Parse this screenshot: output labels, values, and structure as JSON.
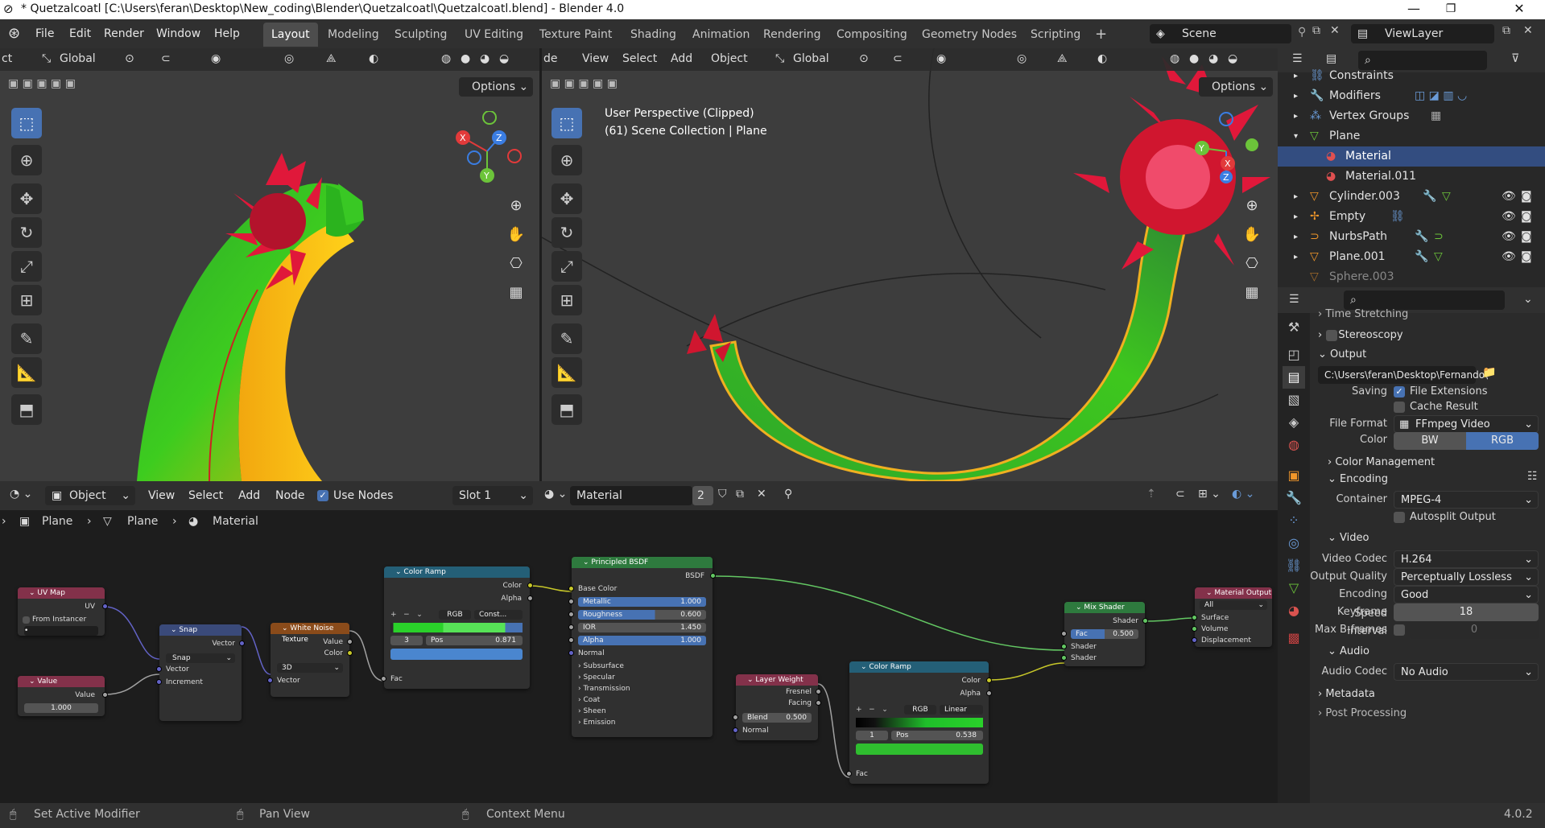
{
  "window": {
    "title": "* Quetzalcoatl [C:\\Users\\feran\\Desktop\\New_coding\\Blender\\Quetzalcoatl\\Quetzalcoatl.blend] - Blender 4.0",
    "minimize": "—",
    "maximize": "❐",
    "close": "✕"
  },
  "menu": [
    "File",
    "Edit",
    "Render",
    "Window",
    "Help"
  ],
  "workspaces": [
    "Layout",
    "Modeling",
    "Sculpting",
    "UV Editing",
    "Texture Paint",
    "Shading",
    "Animation",
    "Rendering",
    "Compositing",
    "Geometry Nodes",
    "Scripting",
    "+"
  ],
  "scene": {
    "label": "Scene",
    "viewlayer": "ViewLayer"
  },
  "viewport_left": {
    "mode_partial": "ct",
    "transform": "Global",
    "options": "Options"
  },
  "viewport_right": {
    "mode_partial": "de",
    "menus": [
      "View",
      "Select",
      "Add",
      "Object"
    ],
    "transform": "Global",
    "options": "Options",
    "info_line1": "User Perspective (Clipped)",
    "info_line2": "(61) Scene Collection | Plane"
  },
  "outliner": {
    "rows": [
      {
        "name": "Constraints",
        "icon": "constraint-icon",
        "indent": 1
      },
      {
        "name": "Modifiers",
        "icon": "wrench-icon",
        "indent": 1
      },
      {
        "name": "Vertex Groups",
        "icon": "vertex-group-icon",
        "indent": 1
      },
      {
        "name": "Plane",
        "icon": "mesh-icon",
        "indent": 1
      },
      {
        "name": "Material",
        "icon": "material-icon",
        "indent": 2
      },
      {
        "name": "Material.011",
        "icon": "material-icon",
        "indent": 2
      },
      {
        "name": "Cylinder.003",
        "icon": "object-icon",
        "indent": 1
      },
      {
        "name": "Empty",
        "icon": "object-icon",
        "indent": 1
      },
      {
        "name": "NurbsPath",
        "icon": "curve-icon",
        "indent": 1
      },
      {
        "name": "Plane.001",
        "icon": "object-icon",
        "indent": 1
      },
      {
        "name": "Sphere.003",
        "icon": "object-icon",
        "indent": 1
      }
    ]
  },
  "properties": {
    "time_stretching": "Time Stretching",
    "stereoscopy": "Stereoscopy",
    "output_header": "Output",
    "output_path": "C:\\Users\\feran\\Desktop\\Fernando\\",
    "saving_label": "Saving",
    "file_extensions": "File Extensions",
    "cache_result": "Cache Result",
    "file_format_label": "File Format",
    "file_format": "FFmpeg Video",
    "color_label": "Color",
    "color_bw": "BW",
    "color_rgb": "RGB",
    "color_management": "Color Management",
    "encoding": "Encoding",
    "container_label": "Container",
    "container": "MPEG-4",
    "autosplit": "Autosplit Output",
    "video_header": "Video",
    "video_codec_label": "Video Codec",
    "video_codec": "H.264",
    "output_quality_label": "Output Quality",
    "output_quality": "Perceptually Lossless",
    "encoding_speed_label": "Encoding Speed",
    "encoding_speed": "Good",
    "keyframe_interval_label": "Keyframe Interval",
    "keyframe_interval": "18",
    "max_bframes_label": "Max B-frames",
    "max_bframes": "0",
    "audio_header": "Audio",
    "audio_codec_label": "Audio Codec",
    "audio_codec": "No Audio",
    "metadata": "Metadata",
    "post_processing": "Post Processing"
  },
  "node_editor": {
    "mode": "Object",
    "menus": [
      "View",
      "Select",
      "Add",
      "Node"
    ],
    "use_nodes": "Use Nodes",
    "slot": "Slot 1",
    "material": "Material",
    "users": "2",
    "breadcrumb": [
      "Plane",
      "Plane",
      "Material"
    ],
    "nodes": {
      "uvmap": {
        "title": "UV Map",
        "out": "UV",
        "from_instancer": "From Instancer"
      },
      "value": {
        "title": "Value",
        "out": "Value",
        "val": "1.000"
      },
      "snap": {
        "title": "Snap",
        "out": "Vector",
        "mode": "Snap",
        "in1": "Vector",
        "in2": "Increment"
      },
      "noise": {
        "title": "White Noise Texture",
        "out1": "Value",
        "out2": "Color",
        "dim": "3D",
        "in": "Vector"
      },
      "ramp1": {
        "title": "Color Ramp",
        "out1": "Color",
        "out2": "Alpha",
        "mode": "RGB",
        "interp": "Const...",
        "index": "3",
        "pos_label": "Pos",
        "pos": "0.871",
        "in": "Fac"
      },
      "bsdf": {
        "title": "Principled BSDF",
        "out": "BSDF",
        "base": "Base Color",
        "metallic": "Metallic",
        "metallic_v": "1.000",
        "roughness": "Roughness",
        "roughness_v": "0.600",
        "ior": "IOR",
        "ior_v": "1.450",
        "alpha": "Alpha",
        "alpha_v": "1.000",
        "normal": "Normal",
        "subs": [
          "Subsurface",
          "Specular",
          "Transmission",
          "Coat",
          "Sheen",
          "Emission"
        ]
      },
      "layer": {
        "title": "Layer Weight",
        "out1": "Fresnel",
        "out2": "Facing",
        "blend": "Blend",
        "blend_v": "0.500",
        "normal": "Normal"
      },
      "ramp2": {
        "title": "Color Ramp",
        "out1": "Color",
        "out2": "Alpha",
        "mode": "RGB",
        "interp": "Linear",
        "index": "1",
        "pos_label": "Pos",
        "pos": "0.538",
        "in": "Fac"
      },
      "mix": {
        "title": "Mix Shader",
        "out": "Shader",
        "fac": "Fac",
        "fac_v": "0.500",
        "in1": "Shader",
        "in2": "Shader"
      },
      "output": {
        "title": "Material Output",
        "target": "All",
        "in1": "Surface",
        "in2": "Volume",
        "in3": "Displacement"
      }
    }
  },
  "statusbar": {
    "item1": "Set Active Modifier",
    "item2": "Pan View",
    "item3": "Context Menu",
    "version": "4.0.2"
  },
  "colors": {
    "accent": "#4772b3",
    "header": "#303030",
    "selection": "#334d80"
  }
}
